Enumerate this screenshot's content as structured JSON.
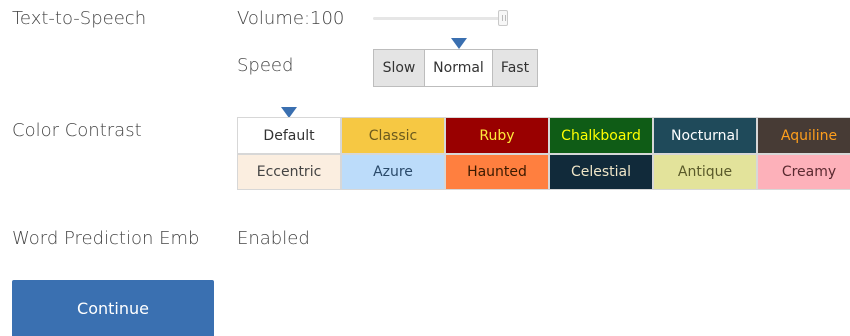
{
  "tts": {
    "label": "Text-to-Speech",
    "volume_label": "Volume:100",
    "volume_level": 100,
    "speed_label": "Speed",
    "speeds": [
      "Slow",
      "Normal",
      "Fast"
    ],
    "selected_speed": "Normal"
  },
  "contrast": {
    "label": "Color Contrast",
    "selected": "Default",
    "options": [
      {
        "name": "Default",
        "bg": "#ffffff",
        "fg": "#333333"
      },
      {
        "name": "Classic",
        "bg": "#f6c843",
        "fg": "#6b5a1e"
      },
      {
        "name": "Ruby",
        "bg": "#990000",
        "fg": "#ffeb3b"
      },
      {
        "name": "Chalkboard",
        "bg": "#0f5c16",
        "fg": "#ffff00"
      },
      {
        "name": "Nocturnal",
        "bg": "#1f4a5a",
        "fg": "#ffffff"
      },
      {
        "name": "Aquiline",
        "bg": "#473b35",
        "fg": "#ff9f1c"
      },
      {
        "name": "Eccentric",
        "bg": "#fbeee0",
        "fg": "#444444"
      },
      {
        "name": "Azure",
        "bg": "#bcdcfa",
        "fg": "#2a4a6a"
      },
      {
        "name": "Haunted",
        "bg": "#ff7f3f",
        "fg": "#3a1a00"
      },
      {
        "name": "Celestial",
        "bg": "#112a3a",
        "fg": "#f0e6c8"
      },
      {
        "name": "Antique",
        "bg": "#e3e39b",
        "fg": "#5a5a2a"
      },
      {
        "name": "Creamy",
        "bg": "#fdb1ba",
        "fg": "#5a2a30"
      }
    ]
  },
  "word_prediction": {
    "label": "Word Prediction Emb",
    "value": "Enabled"
  },
  "continue_label": "Continue",
  "colors": {
    "accent": "#3a70b1",
    "marker": "#3a6fb0"
  }
}
